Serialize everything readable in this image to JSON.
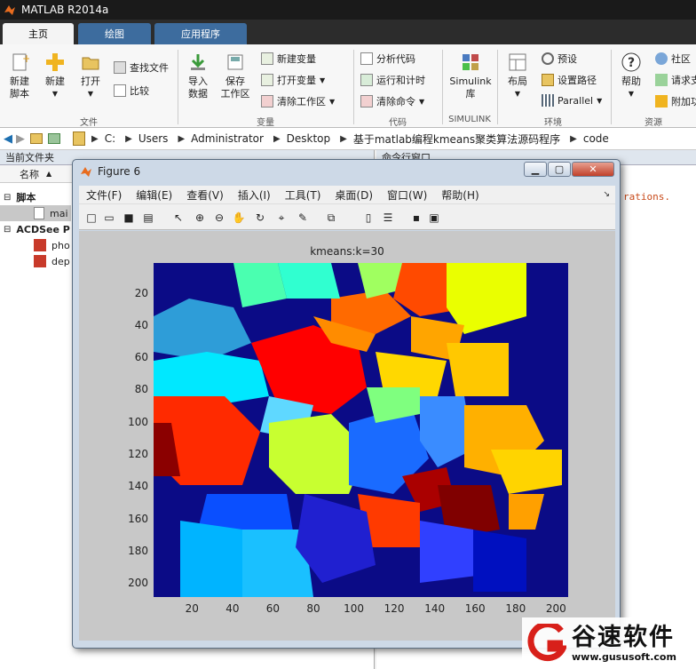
{
  "app": {
    "title": "MATLAB R2014a"
  },
  "tabs": [
    {
      "label": "主页"
    },
    {
      "label": "绘图"
    },
    {
      "label": "应用程序"
    }
  ],
  "ribbon": {
    "new_script": "新建\n脚本",
    "new": "新建",
    "open": "打开",
    "find_files": "查找文件",
    "compare": "比较",
    "import_data": "导入\n数据",
    "save_workspace": "保存\n工作区",
    "new_variable": "新建变量",
    "open_variable": "打开变量",
    "clear_workspace": "清除工作区",
    "analyze_code": "分析代码",
    "run_and_time": "运行和计时",
    "clear_commands": "清除命令",
    "simulink": "Simulink\n库",
    "layout": "布局",
    "preferences": "预设",
    "set_path": "设置路径",
    "parallel": "Parallel",
    "help": "帮助",
    "community": "社区",
    "request_support": "请求支",
    "addons": "附加功",
    "groups": {
      "file": "文件",
      "variable": "变量",
      "code": "代码",
      "simulink": "SIMULINK",
      "environment": "环境",
      "resources": "资源"
    }
  },
  "address": {
    "crumbs": [
      "C:",
      "Users",
      "Administrator",
      "Desktop",
      "基于matlab编程kmeans聚类算法源码程序",
      "code"
    ]
  },
  "current_folder": {
    "title": "当前文件夹",
    "column_name": "名称",
    "sections": [
      {
        "label": "脚本",
        "items": [
          {
            "name": "mai"
          }
        ]
      },
      {
        "label": "ACDSee P",
        "items": [
          {
            "name": "pho"
          },
          {
            "name": "dep"
          }
        ]
      }
    ]
  },
  "command_window": {
    "title": "命令行窗口",
    "text": "rations."
  },
  "figure": {
    "title": "Figure 6",
    "menu": [
      "文件(F)",
      "编辑(E)",
      "查看(V)",
      "插入(I)",
      "工具(T)",
      "桌面(D)",
      "窗口(W)",
      "帮助(H)"
    ],
    "toolbar_icons": [
      "new-figure-icon",
      "open-icon",
      "save-icon",
      "print-icon",
      "pointer-icon",
      "zoom-in-icon",
      "zoom-out-icon",
      "pan-icon",
      "rotate-icon",
      "data-cursor-icon",
      "brush-icon",
      "link-icon",
      "colorbar-icon",
      "legend-icon",
      "hide-plot-tools-icon",
      "show-plot-tools-icon"
    ]
  },
  "chart_data": {
    "type": "heatmap",
    "title": "kmeans:k=30",
    "xlabel": "",
    "ylabel": "",
    "xlim": [
      1,
      206
    ],
    "ylim": [
      1,
      208
    ],
    "xticks": [
      20,
      40,
      60,
      80,
      100,
      120,
      140,
      160,
      180,
      200
    ],
    "yticks": [
      20,
      40,
      60,
      80,
      100,
      120,
      140,
      160,
      180,
      200
    ],
    "colormap": "jet",
    "clusters": 30
  },
  "watermark": {
    "cn": "谷速软件",
    "url": "www.gususoft.com"
  }
}
